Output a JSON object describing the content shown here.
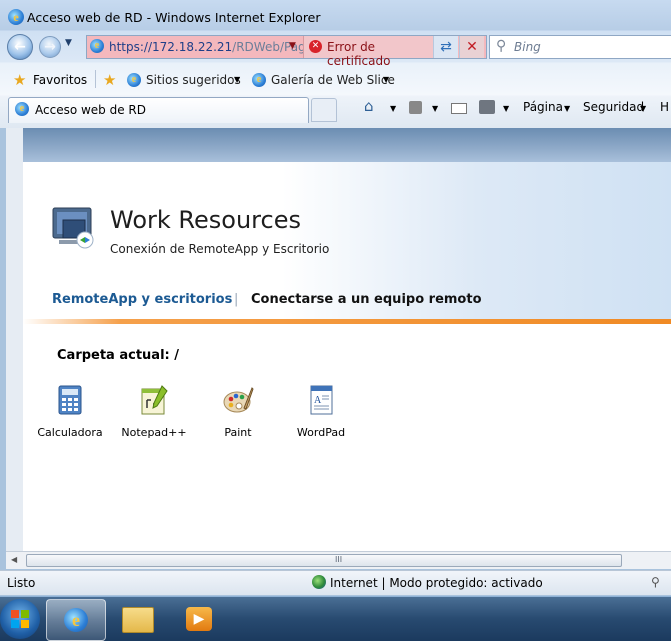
{
  "window": {
    "title": "Acceso web de RD - Windows Internet Explorer"
  },
  "address_bar": {
    "url_main": "https://172.18.22.21",
    "url_rest": "/RDWeb/Pag",
    "cert_error": "Error de certificado"
  },
  "search": {
    "placeholder": "Bing"
  },
  "favorites_bar": {
    "favorites": "Favoritos",
    "suggested": "Sitios sugeridos",
    "webslice": "Galería de Web Slice"
  },
  "tab": {
    "title": "Acceso web de RD"
  },
  "command_bar": {
    "page": "Página",
    "security": "Seguridad",
    "more": "H"
  },
  "page": {
    "title": "Work Resources",
    "subtitle": "Conexión de RemoteApp y Escritorio",
    "nav": {
      "remoteapp": "RemoteApp y escritorios",
      "separator": "|",
      "remote_pc": "Conectarse a un equipo remoto"
    },
    "current_folder": "Carpeta actual: /",
    "apps": [
      {
        "name": "Calculadora",
        "icon": "calculator-icon"
      },
      {
        "name": "Notepad++",
        "icon": "notepad-plus-plus-icon"
      },
      {
        "name": "Paint",
        "icon": "paint-palette-icon"
      },
      {
        "name": "WordPad",
        "icon": "wordpad-icon"
      }
    ]
  },
  "scrollbar": {
    "grip": "III"
  },
  "status_bar": {
    "status": "Listo",
    "zone": "Internet | Modo protegido: activado"
  },
  "colors": {
    "nav_link": "#1c5a93",
    "accent_orange": "#f08a24",
    "cert_error_bg": "#f4b8bd"
  }
}
